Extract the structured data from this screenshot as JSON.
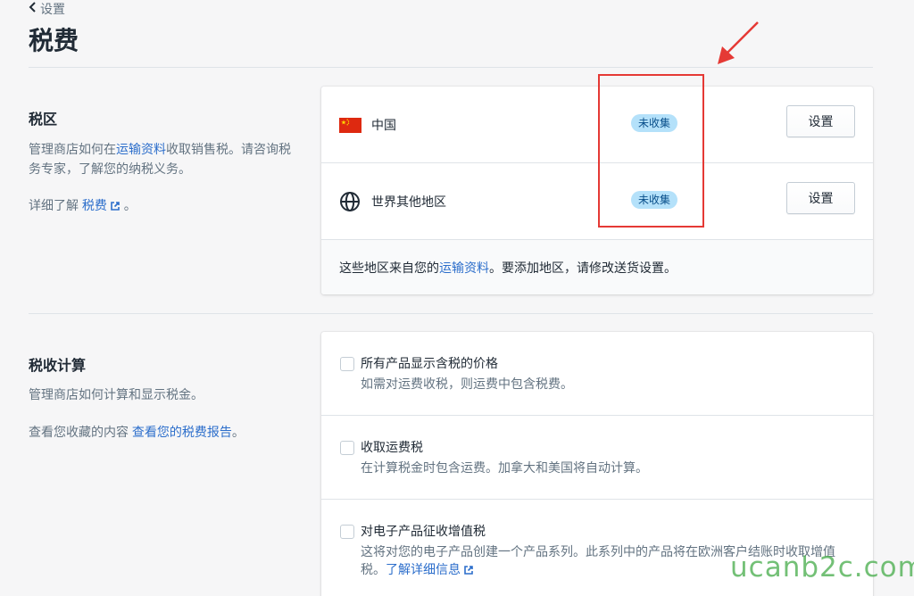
{
  "header": {
    "back_label": "设置",
    "title": "税费"
  },
  "tax_regions": {
    "title": "税区",
    "desc_prefix": "管理商店如何在",
    "desc_link": "运输资料",
    "desc_suffix": "收取销售税。请咨询税务专家，了解您的纳税义务。",
    "learn_prefix": "详细了解 ",
    "learn_link": "税费",
    "learn_suffix": " 。",
    "zones": [
      {
        "name": "中国",
        "icon": "china-flag-icon",
        "status": "未收集",
        "button": "设置"
      },
      {
        "name": "世界其他地区",
        "icon": "globe-icon",
        "status": "未收集",
        "button": "设置"
      }
    ],
    "footer_prefix": "这些地区来自您的",
    "footer_link": "运输资料",
    "footer_suffix": "。要添加地区，请修改送货设置。"
  },
  "tax_calculation": {
    "title": "税收计算",
    "desc": "管理商店如何计算和显示税金。",
    "report_prefix": "查看您收藏的内容 ",
    "report_link": "查看您的税费报告",
    "report_suffix": "。",
    "options": [
      {
        "title": "所有产品显示含税的价格",
        "desc": "如需对运费收税，则运费中包含税费。"
      },
      {
        "title": "收取运费税",
        "desc": "在计算税金时包含运费。加拿大和美国将自动计算。"
      },
      {
        "title": "对电子产品征收增值税",
        "desc": "这将对您的电子产品创建一个产品系列。此系列中的产品将在欧洲客户结账时收取增值税。",
        "link": "了解详细信息"
      }
    ]
  },
  "watermark": "ucanb2c.com",
  "colors": {
    "link": "#2c6ecb",
    "badge_bg": "#b4e1fa",
    "badge_text": "#084e8a",
    "annotation": "#e53935"
  }
}
